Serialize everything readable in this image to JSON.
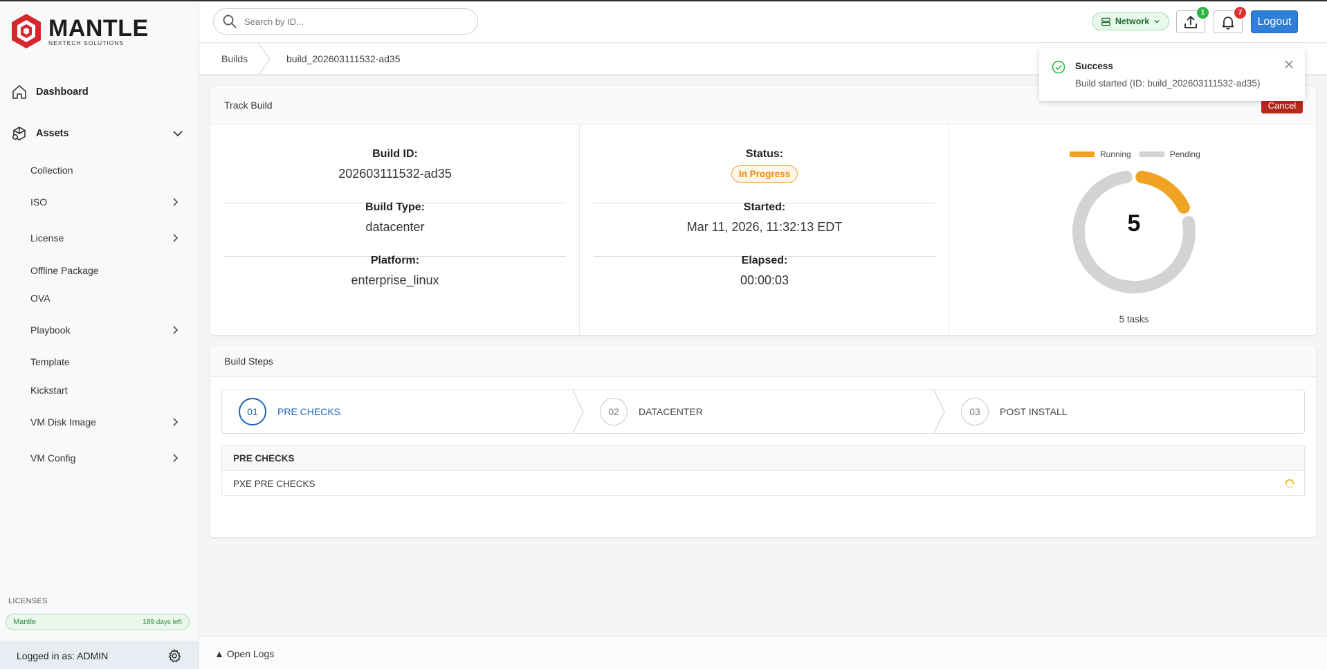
{
  "brand": {
    "name": "MANTLE",
    "tagline": "NEXTECH SOLUTIONS",
    "color": "#d8262f"
  },
  "sidebar": {
    "top_items": [
      {
        "label": "Dashboard",
        "icon": "home-icon"
      },
      {
        "label": "Assets",
        "icon": "assets-icon",
        "expanded": true
      }
    ],
    "sub_items": [
      {
        "label": "Collection",
        "has_children": false
      },
      {
        "label": "ISO",
        "has_children": true
      },
      {
        "label": "License",
        "has_children": true
      },
      {
        "label": "Offline Package",
        "has_children": false
      },
      {
        "label": "OVA",
        "has_children": false
      },
      {
        "label": "Playbook",
        "has_children": true
      },
      {
        "label": "Template",
        "has_children": false
      },
      {
        "label": "Kickstart",
        "has_children": false
      },
      {
        "label": "VM Disk Image",
        "has_children": true
      },
      {
        "label": "VM Config",
        "has_children": true
      }
    ],
    "licenses_label": "LICENSES",
    "license": {
      "name": "Mantle",
      "days_left": "189 days left"
    },
    "logged_in": "Logged in as: ADMIN"
  },
  "header": {
    "search_placeholder": "Search by ID...",
    "network_label": "Network",
    "upload_badge": "1",
    "notification_badge": "7",
    "logout_label": "Logout",
    "colors": {
      "badge_green": "#2fb344",
      "badge_red": "#e03131",
      "logout": "#2f7fd8"
    }
  },
  "breadcrumb": {
    "root": "Builds",
    "current": "build_202603111532-ad35"
  },
  "toast": {
    "title": "Success",
    "message": "Build started (ID: build_202603111532-ad35)"
  },
  "track": {
    "title": "Track Build",
    "cancel_label": "Cancel",
    "fields": {
      "build_id_label": "Build ID:",
      "build_id": "202603111532-ad35",
      "build_type_label": "Build Type:",
      "build_type": "datacenter",
      "platform_label": "Platform:",
      "platform": "enterprise_linux",
      "status_label": "Status:",
      "status": "In Progress",
      "started_label": "Started:",
      "started": "Mar 11, 2026, 11:32:13 EDT",
      "elapsed_label": "Elapsed:",
      "elapsed": "00:00:03"
    },
    "legend": {
      "running": "Running",
      "pending": "Pending"
    },
    "total_tasks": "5",
    "tasks_label": "5 tasks",
    "running_fraction": 0.2,
    "colors": {
      "running": "#f0a323",
      "pending": "#d3d3d3",
      "status": "#e8890c"
    }
  },
  "steps": {
    "title": "Build Steps",
    "items": [
      {
        "num": "01",
        "label": "PRE CHECKS",
        "active": true
      },
      {
        "num": "02",
        "label": "DATACENTER",
        "active": false
      },
      {
        "num": "03",
        "label": "POST INSTALL",
        "active": false
      }
    ],
    "stage_title": "PRE CHECKS",
    "stage_rows": [
      {
        "label": "PXE PRE CHECKS",
        "state": "running"
      }
    ],
    "active_color": "#1f63b5"
  },
  "logs": {
    "label": "▲ Open Logs"
  }
}
